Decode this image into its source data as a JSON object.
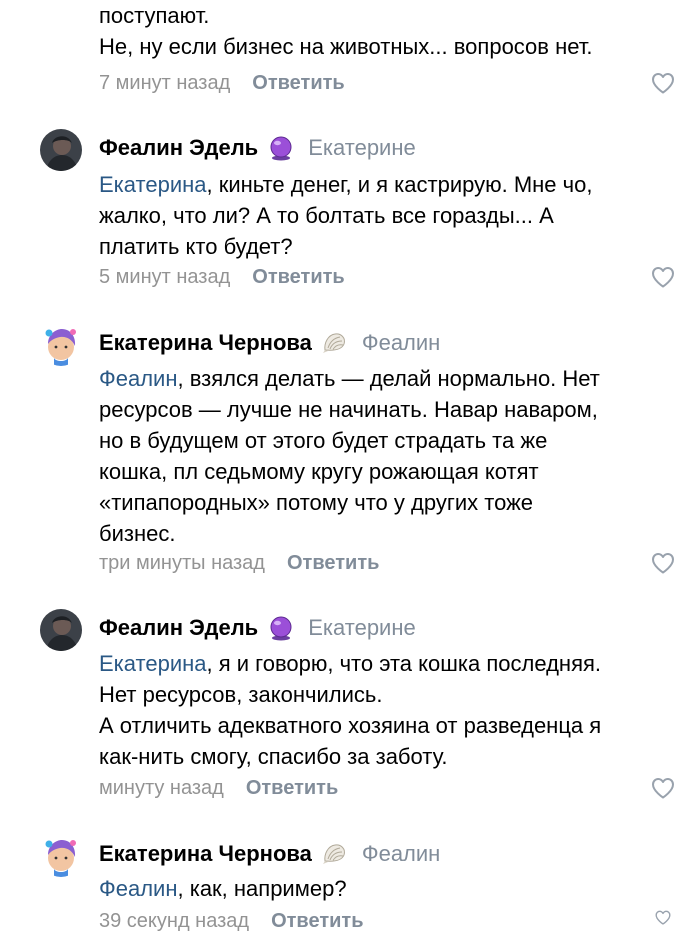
{
  "top_comment": {
    "lines": [
      "поступают.",
      "Не, ну если бизнес на животных... вопросов нет."
    ],
    "time": "7 минут назад",
    "reply_label": "Ответить"
  },
  "comments": [
    {
      "author": "Феалин Эдель",
      "status_icon": "crystal-ball-icon",
      "reply_to": "Екатерине",
      "mention": "Екатерина",
      "lines": [
        ", киньте денег, и я кастрирую. Мне чо,",
        "жалко, что ли? А то болтать все горазды... А",
        "платить кто будет?"
      ],
      "time": "5 минут назад",
      "reply_label": "Ответить"
    },
    {
      "author": "Екатерина Чернова",
      "status_icon": "seashell-icon",
      "reply_to": "Феалин",
      "mention": "Феалин",
      "lines": [
        ", взялся делать — делай нормально. Нет",
        "ресурсов — лучше не начинать. Навар наваром,",
        "но в будущем от этого будет страдать та же",
        "кошка, пл седьмому кругу рожающая котят",
        "«типапородных» потому что у других тоже",
        "бизнес."
      ],
      "time": "три минуты назад",
      "reply_label": "Ответить"
    },
    {
      "author": "Феалин Эдель",
      "status_icon": "crystal-ball-icon",
      "reply_to": "Екатерине",
      "mention": "Екатерина",
      "lines": [
        ", я и говорю, что эта кошка последняя.",
        "Нет ресурсов, закончились.",
        "А отличить адекватного хозяина от разведенца я",
        "как-нить смогу, спасибо за заботу."
      ],
      "time": "минуту назад",
      "reply_label": "Ответить"
    },
    {
      "author": "Екатерина Чернова",
      "status_icon": "seashell-icon",
      "reply_to": "Феалин",
      "mention": "Феалин",
      "lines": [
        ", как, например?"
      ],
      "time": "39 секунд назад",
      "reply_label": "Ответить"
    }
  ],
  "colors": {
    "text": "#000000",
    "secondary": "#939393",
    "action": "#818c99",
    "mention": "#2a5885"
  }
}
